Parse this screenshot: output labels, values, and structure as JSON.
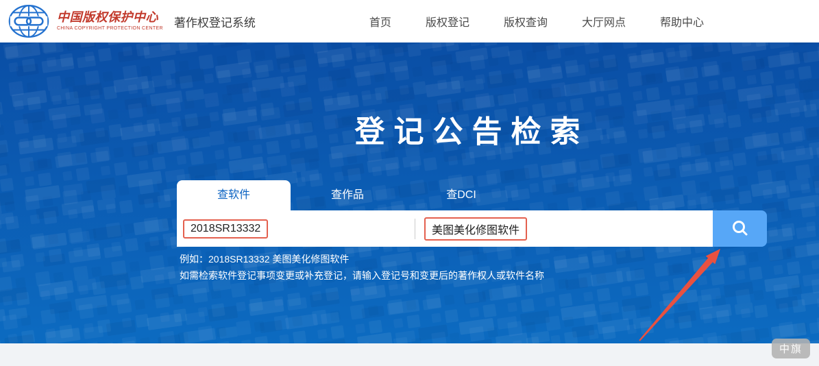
{
  "header": {
    "logo": {
      "name_cn": "中国版权保护中心",
      "name_en": "CHINA COPYRIGHT PROTECTION CENTER"
    },
    "system_title": "著作权登记系统",
    "nav": [
      {
        "label": "首页"
      },
      {
        "label": "版权登记"
      },
      {
        "label": "版权查询"
      },
      {
        "label": "大厅网点"
      },
      {
        "label": "帮助中心"
      }
    ]
  },
  "hero": {
    "title": "登记公告检索",
    "tabs": [
      {
        "label": "查软件",
        "active": true
      },
      {
        "label": "查作品",
        "active": false
      },
      {
        "label": "查DCI",
        "active": false
      }
    ],
    "search": {
      "registration_number_value": "2018SR13332",
      "work_name_value": "美图美化修图软件",
      "button_icon": "search-magnifier-icon"
    },
    "hints": [
      "例如：2018SR13332 美图美化修图软件",
      "如需检索软件登记事项变更或补充登记，请输入登记号和变更后的著作权人或软件名称"
    ]
  },
  "annotations": {
    "arrow_target": "search-button",
    "highlight_boxes": [
      "2018SR13332",
      "美图美化修图软件"
    ]
  },
  "watermark": {
    "label": "中旗"
  },
  "colors": {
    "brand_red": "#c23a2c",
    "logo_blue": "#2472cf",
    "hero_blue_top": "#0a4ea5",
    "hero_blue_bottom": "#0c6bc1",
    "search_button_blue": "#57a7f7",
    "active_tab_blue": "#0a62c2",
    "annotation_red": "#e95140",
    "footer_gray": "#f1f3f6"
  }
}
